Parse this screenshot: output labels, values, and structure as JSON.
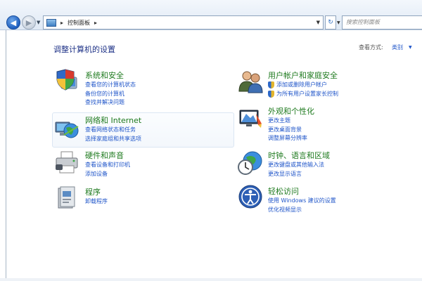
{
  "address_bar": {
    "breadcrumb_root_sep": "▸",
    "breadcrumb": "控制面板",
    "breadcrumb_end_sep": "▸",
    "search_placeholder": "搜索控制面板"
  },
  "header": {
    "title": "调整计算机的设置",
    "view_by_label": "查看方式:",
    "view_by_value": "类别"
  },
  "categories": [
    {
      "title": "系统和安全",
      "icon": "shield-computer-icon",
      "links": [
        "查看您的计算机状态",
        "备份您的计算机",
        "查找并解决问题"
      ]
    },
    {
      "title": "网络和 Internet",
      "icon": "network-globe-icon",
      "links": [
        "查看网络状态和任务",
        "选择家庭组和共享选项"
      ]
    },
    {
      "title": "硬件和声音",
      "icon": "printer-icon",
      "links": [
        "查看设备和打印机",
        "添加设备"
      ]
    },
    {
      "title": "程序",
      "icon": "programs-icon",
      "links": [
        "卸载程序"
      ]
    },
    {
      "title": "用户帐户和家庭安全",
      "icon": "users-icon",
      "links": [
        "添加或删除用户帐户",
        "为所有用户设置家长控制"
      ]
    },
    {
      "title": "外观和个性化",
      "icon": "appearance-icon",
      "links": [
        "更改主题",
        "更改桌面背景",
        "调整屏幕分辨率"
      ]
    },
    {
      "title": "时钟、语言和区域",
      "icon": "clock-globe-icon",
      "links": [
        "更改键盘或其他输入法",
        "更改显示语言"
      ]
    },
    {
      "title": "轻松访问",
      "icon": "ease-of-access-icon",
      "links": [
        "使用 Windows 建议的设置",
        "优化视频显示"
      ]
    }
  ],
  "colors": {
    "title_green": "#1e7a1e",
    "link_blue": "#1f55c9",
    "heading_blue": "#1e3287"
  }
}
